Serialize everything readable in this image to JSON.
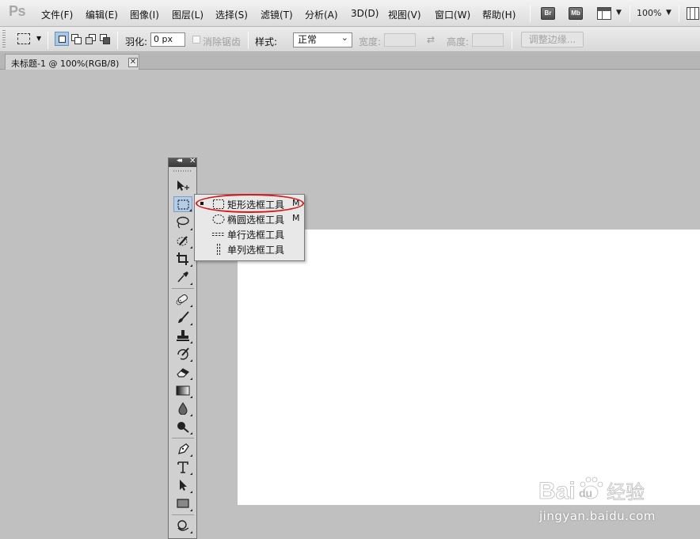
{
  "app": {
    "logo": "Ps",
    "menu": [
      "文件(F)",
      "编辑(E)",
      "图像(I)",
      "图层(L)",
      "选择(S)",
      "滤镜(T)",
      "分析(A)",
      "3D(D)",
      "视图(V)",
      "窗口(W)",
      "帮助(H)"
    ],
    "bridge_label": "Br",
    "minibridge_label": "Mb",
    "zoom": "100%"
  },
  "options": {
    "feather_label": "羽化:",
    "feather_value": "0 px",
    "antialias_label": "消除锯齿",
    "style_label": "样式:",
    "style_value": "正常",
    "width_label": "宽度:",
    "height_label": "高度:",
    "refine_edge_label": "调整边缘..."
  },
  "document": {
    "tab_title": "未标题-1 @ 100%(RGB/8)",
    "close_glyph": "✕"
  },
  "tools": {
    "items": [
      "move-tool",
      "rectangular-marquee-tool",
      "lasso-tool",
      "quick-selection-tool",
      "crop-tool",
      "eyedropper-tool",
      "spot-healing-brush-tool",
      "brush-tool",
      "clone-stamp-tool",
      "history-brush-tool",
      "eraser-tool",
      "gradient-tool",
      "blur-tool",
      "dodge-tool",
      "pen-tool",
      "type-tool",
      "path-selection-tool",
      "rectangle-tool",
      "3d-rotate-tool"
    ],
    "active": "rectangular-marquee-tool"
  },
  "flyout": {
    "items": [
      {
        "label": "矩形选框工具",
        "shortcut": "M",
        "selected": true,
        "icon": "rect-marquee-icon"
      },
      {
        "label": "椭圆选框工具",
        "shortcut": "M",
        "selected": false,
        "icon": "ellipse-marquee-icon"
      },
      {
        "label": "单行选框工具",
        "shortcut": "",
        "selected": false,
        "icon": "single-row-marquee-icon"
      },
      {
        "label": "单列选框工具",
        "shortcut": "",
        "selected": false,
        "icon": "single-column-marquee-icon"
      }
    ],
    "highlight_color": "#d61919"
  },
  "watermark": {
    "logo": "Baidu经验",
    "url": "jingyan.baidu.com"
  }
}
